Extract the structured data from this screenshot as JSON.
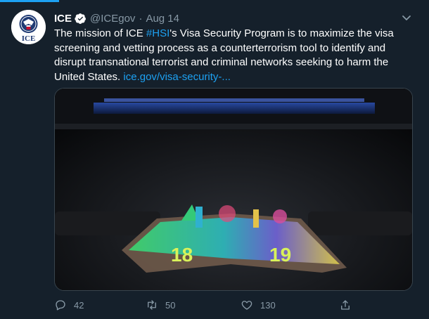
{
  "tweet": {
    "display_name": "ICE",
    "handle": "@ICEgov",
    "separator": "·",
    "date": "Aug 14",
    "text_before_hashtag": "The mission of ICE ",
    "hashtag": "#HSI",
    "text_after_hashtag": "'s Visa Security Program is to maximize the visa screening and vetting process as a counterterrorism tool to identify and disrupt transnational terrorist and criminal networks seeking to harm the United States. ",
    "link_text": "ice.gov/visa-security-...",
    "avatar_label": "ICE",
    "media": {
      "year_left": "18",
      "year_right": "19"
    }
  },
  "actions": {
    "replies": "42",
    "retweets": "50",
    "likes": "130"
  },
  "colors": {
    "background": "#15202b",
    "accent": "#1da1f2",
    "muted": "#8899a6"
  },
  "icons": [
    "verified-badge-icon",
    "chevron-down-icon",
    "reply-icon",
    "retweet-icon",
    "like-icon",
    "share-icon"
  ]
}
